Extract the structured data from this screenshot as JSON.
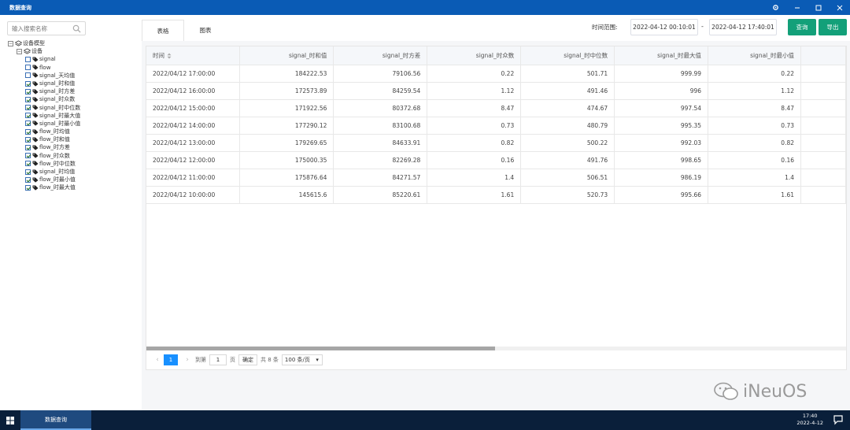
{
  "window": {
    "title": "数据查询",
    "controls": {
      "settings": "⚙",
      "minimize": "—",
      "maximize": "☐",
      "close": "✕"
    }
  },
  "sidebar": {
    "search_placeholder": "输入搜索名称",
    "tree": [
      {
        "label": "设备模型",
        "level": 0,
        "kind": "group",
        "expander": "⊟"
      },
      {
        "label": "设备",
        "level": 1,
        "kind": "group",
        "expander": "⊟"
      },
      {
        "label": "signal",
        "level": 2,
        "checked": false
      },
      {
        "label": "flow",
        "level": 2,
        "checked": false
      },
      {
        "label": "signal_天均值",
        "level": 2,
        "checked": false
      },
      {
        "label": "signal_时和值",
        "level": 2,
        "checked": true
      },
      {
        "label": "signal_时方差",
        "level": 2,
        "checked": true
      },
      {
        "label": "signal_时众数",
        "level": 2,
        "checked": true
      },
      {
        "label": "signal_时中位数",
        "level": 2,
        "checked": true
      },
      {
        "label": "signal_时最大值",
        "level": 2,
        "checked": true
      },
      {
        "label": "signal_时最小值",
        "level": 2,
        "checked": true
      },
      {
        "label": "flow_时均值",
        "level": 2,
        "checked": true
      },
      {
        "label": "flow_时和值",
        "level": 2,
        "checked": true
      },
      {
        "label": "flow_时方差",
        "level": 2,
        "checked": true
      },
      {
        "label": "flow_时众数",
        "level": 2,
        "checked": true
      },
      {
        "label": "flow_时中位数",
        "level": 2,
        "checked": true
      },
      {
        "label": "signal_时均值",
        "level": 2,
        "checked": true
      },
      {
        "label": "flow_时最小值",
        "level": 2,
        "checked": true
      },
      {
        "label": "flow_时最大值",
        "level": 2,
        "checked": true
      }
    ]
  },
  "tabs": [
    {
      "label": "表格",
      "active": true
    },
    {
      "label": "图表",
      "active": false
    }
  ],
  "filter": {
    "range_label": "时间范围:",
    "start": "2022-04-12 00:10:01",
    "separator": "-",
    "end": "2022-04-12 17:40:01",
    "query_button": "查询",
    "export_button": "导出"
  },
  "table": {
    "columns": [
      "时间",
      "signal_时和值",
      "signal_时方差",
      "signal_时众数",
      "signal_时中位数",
      "signal_时最大值",
      "signal_时最小值"
    ],
    "rows": [
      [
        "2022/04/12 17:00:00",
        "184222.53",
        "79106.56",
        "0.22",
        "501.71",
        "999.99",
        "0.22"
      ],
      [
        "2022/04/12 16:00:00",
        "172573.89",
        "84259.54",
        "1.12",
        "491.46",
        "996",
        "1.12"
      ],
      [
        "2022/04/12 15:00:00",
        "171922.56",
        "80372.68",
        "8.47",
        "474.67",
        "997.54",
        "8.47"
      ],
      [
        "2022/04/12 14:00:00",
        "177290.12",
        "83100.68",
        "0.73",
        "480.79",
        "995.35",
        "0.73"
      ],
      [
        "2022/04/12 13:00:00",
        "179269.65",
        "84633.91",
        "0.82",
        "500.22",
        "992.03",
        "0.82"
      ],
      [
        "2022/04/12 12:00:00",
        "175000.35",
        "82269.28",
        "0.16",
        "491.76",
        "998.65",
        "0.16"
      ],
      [
        "2022/04/12 11:00:00",
        "175876.64",
        "84271.57",
        "1.4",
        "506.51",
        "986.19",
        "1.4"
      ],
      [
        "2022/04/12 10:00:00",
        "145615.6",
        "85220.61",
        "1.61",
        "520.73",
        "995.66",
        "1.61"
      ]
    ]
  },
  "pagination": {
    "prev": "‹",
    "current_page": "1",
    "next": "›",
    "goto_label": "到第",
    "goto_value": "1",
    "page_unit": "页",
    "confirm": "确定",
    "total": "共 8 条",
    "page_size": "100 条/页"
  },
  "watermark": {
    "text": "iNeuOS"
  },
  "taskbar": {
    "app_label": "数据查询",
    "time": "17:40",
    "date": "2022-4-12"
  },
  "colors": {
    "titlebar": "#0a5bb5",
    "accent_button": "#13a079",
    "page_active": "#1890ff",
    "taskbar": "#0a1f3a"
  }
}
